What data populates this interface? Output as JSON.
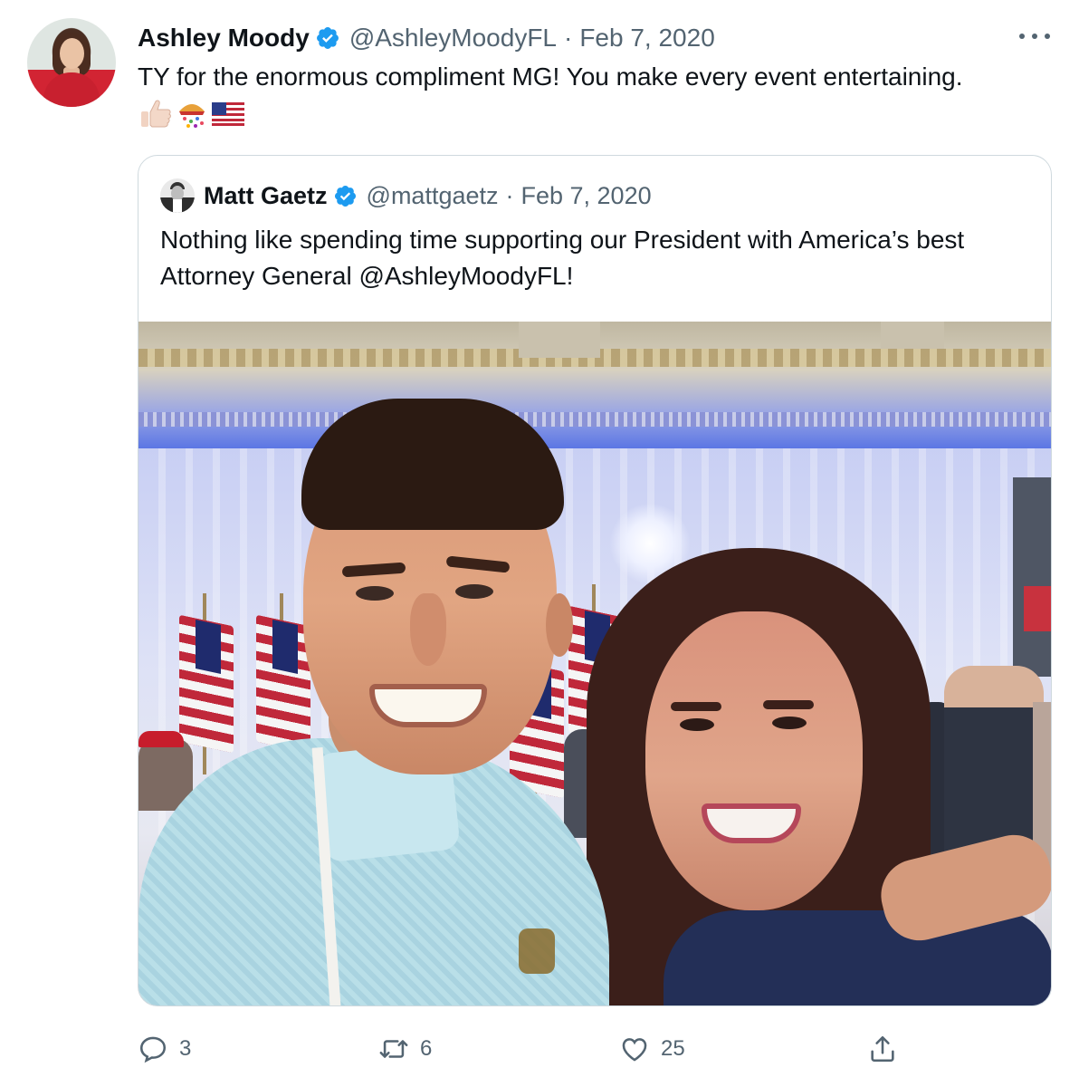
{
  "tweet": {
    "author_name": "Ashley Moody",
    "author_handle": "@AshleyMoodyFL",
    "separator": "·",
    "date": "Feb 7, 2020",
    "text": "TY for the enormous compliment MG! You make every event entertaining.",
    "emojis": [
      "thumbs-up-emoji",
      "confetti-ball-emoji",
      "us-flag-emoji"
    ],
    "more_icon": "ellipsis-icon"
  },
  "quoted_tweet": {
    "author_name": "Matt Gaetz",
    "author_handle": "@mattgaetz",
    "separator": "·",
    "date": "Feb 7, 2020",
    "text": "Nothing like spending time supporting our President with America’s best Attorney General @AshleyMoodyFL!"
  },
  "actions": {
    "reply_icon": "reply-icon",
    "reply_count": "3",
    "retweet_icon": "retweet-icon",
    "retweet_count": "6",
    "like_icon": "heart-icon",
    "like_count": "25",
    "share_icon": "share-icon"
  },
  "colors": {
    "verified": "#1d9bf0",
    "secondary_text": "#536471",
    "primary_text": "#0f1419",
    "border": "#cfd9de"
  }
}
